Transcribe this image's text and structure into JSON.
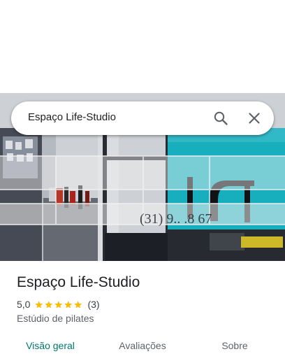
{
  "search": {
    "query": "Espaço Life-Studio"
  },
  "place": {
    "name": "Espaço Life-Studio",
    "rating": "5,0",
    "stars": 5,
    "review_count": "(3)",
    "category": "Estúdio de pilates"
  },
  "tabs": [
    {
      "label": "Visão geral",
      "active": true
    },
    {
      "label": "Avaliações",
      "active": false
    },
    {
      "label": "Sobre",
      "active": false
    }
  ],
  "photo": {
    "window_text": "(31) 9.. .8 67"
  },
  "colors": {
    "accent": "#00796b",
    "star": "#fbbc04",
    "wall_accent": "#19b8c8"
  }
}
